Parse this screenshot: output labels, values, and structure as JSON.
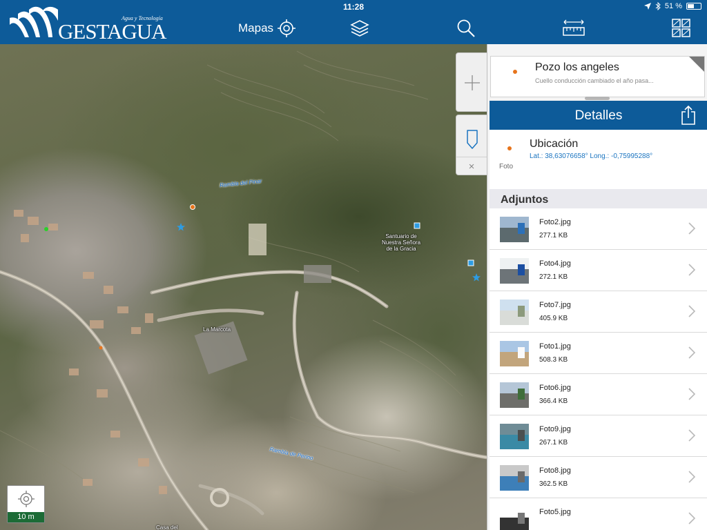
{
  "status_bar": {
    "time": "11:28",
    "battery_text": "51 %",
    "battery_fraction": 0.51
  },
  "brand": {
    "name": "GESTAGUA",
    "tagline": "Agua y Tecnología"
  },
  "toolbar": {
    "maps_label": "Mapas",
    "buttons": [
      {
        "name": "locate",
        "icon": "crosshair-icon"
      },
      {
        "name": "layers",
        "icon": "layers-icon"
      },
      {
        "name": "search",
        "icon": "search-icon"
      },
      {
        "name": "measure",
        "icon": "ruler-icon"
      },
      {
        "name": "basemap",
        "icon": "grid-map-icon"
      }
    ]
  },
  "map": {
    "labels": {
      "rambla_pinar": "Rambla del Pinar",
      "rambla_perino": "Rambla de Perino",
      "santuario": "Santuario de\nNuestra Señora\nde la Gracia",
      "marcota": "La Marcota",
      "casa": "Casa del"
    },
    "scale_label": "10 m",
    "zoom_icon": "plus-icon",
    "pin_icon": "marker-icon",
    "close_icon": "close-icon",
    "close_glyph": "×"
  },
  "feature": {
    "title": "Pozo los angeles",
    "subtitle": "Cuello conducción cambiado el año pasa..."
  },
  "details": {
    "header": "Detalles",
    "location_title": "Ubicación",
    "coords": "Lat.: 38,63076658° Long.: -0,75995288°",
    "foto_label": "Foto"
  },
  "attachments": {
    "header": "Adjuntos",
    "items": [
      {
        "name": "Foto2.jpg",
        "size": "277.1 KB",
        "thumb": [
          "#9fb7cf",
          "#5c6a6e",
          "#2c70b8"
        ]
      },
      {
        "name": "Foto4.jpg",
        "size": "272.1 KB",
        "thumb": [
          "#eef1f2",
          "#6d7478",
          "#1c4fa2"
        ]
      },
      {
        "name": "Foto7.jpg",
        "size": "405.9 KB",
        "thumb": [
          "#cfe0ef",
          "#d9dcd8",
          "#8c9a7c"
        ]
      },
      {
        "name": "Foto1.jpg",
        "size": "508.3 KB",
        "thumb": [
          "#aac6e4",
          "#c2a57c",
          "#fafafa"
        ]
      },
      {
        "name": "Foto6.jpg",
        "size": "366.4 KB",
        "thumb": [
          "#b5c6d7",
          "#6e6e6a",
          "#3f6e3a"
        ]
      },
      {
        "name": "Foto9.jpg",
        "size": "267.1 KB",
        "thumb": [
          "#6f8c96",
          "#3a8aa5",
          "#4b4f4f"
        ]
      },
      {
        "name": "Foto8.jpg",
        "size": "362.5 KB",
        "thumb": [
          "#c9c9c9",
          "#3d7fb8",
          "#6a6a6a"
        ]
      },
      {
        "name": "Foto5.jpg",
        "size": "",
        "thumb": [
          "#ffffff",
          "#333333",
          "#777777"
        ]
      }
    ]
  },
  "colors": {
    "brand_blue": "#0d5b99",
    "scale_green": "#1c6b36",
    "link_blue": "#1a74c0"
  }
}
